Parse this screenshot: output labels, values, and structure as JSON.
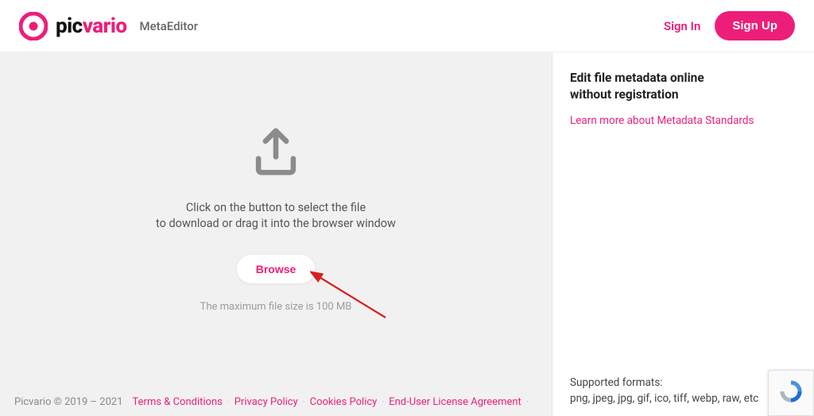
{
  "header": {
    "logo_pic": "pic",
    "logo_vario": "vario",
    "product": "MetaEditor",
    "signin": "Sign In",
    "signup": "Sign Up"
  },
  "upload": {
    "line1": "Click on the button to select the file",
    "line2": "to download or drag it into the browser window",
    "browse": "Browse",
    "max_size": "The maximum file size is 100 MB"
  },
  "footer": {
    "copyright": "Picvario © 2019 – 2021",
    "links": {
      "terms": "Terms & Conditions",
      "privacy": "Privacy Policy",
      "cookies": "Cookies Policy",
      "eula": "End-User License Agreement"
    }
  },
  "side": {
    "title_l1": "Edit file metadata online",
    "title_l2": "without registration",
    "learn": "Learn more about Metadata Standards",
    "formats_label": "Supported formats:",
    "formats_list": "png, jpeg, jpg, gif, ico, tiff, webp, raw, etc"
  }
}
